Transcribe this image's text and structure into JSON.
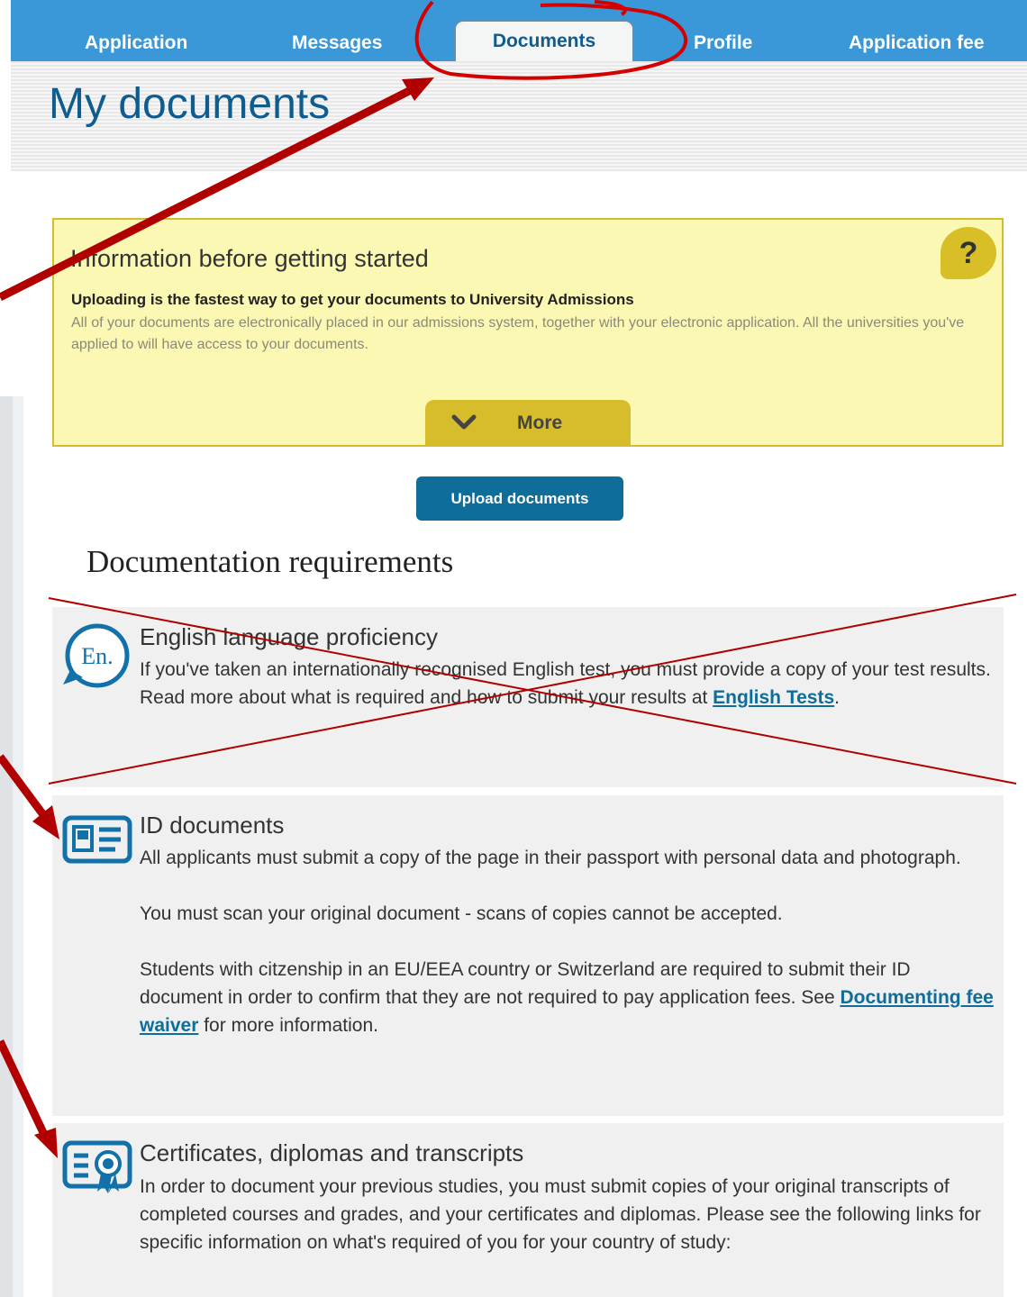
{
  "nav": {
    "tabs": [
      {
        "label": "Application"
      },
      {
        "label": "Messages"
      },
      {
        "label": "Documents",
        "active": true
      },
      {
        "label": "Profile"
      },
      {
        "label": "Application fee"
      }
    ]
  },
  "page": {
    "title": "My documents"
  },
  "info_box": {
    "heading": "Information before getting started",
    "subheading": "Uploading is the fastest way to get your documents to University Admissions",
    "body": "All of your documents are electronically placed in our admissions system, together with your electronic application. All the universities you've applied to will have access to your documents.",
    "help_label": "?",
    "more_label": "More"
  },
  "upload_label": "Upload documents",
  "requirements": {
    "heading": "Documentation requirements",
    "english": {
      "title": "English language proficiency",
      "text": "If you've taken an internationally recognised English test, you must provide a copy of your test results. Read more about what is required and how to submit your results at ",
      "link": "English Tests",
      "suffix": ".",
      "icon_text": "En."
    },
    "id": {
      "title": "ID documents",
      "p1": "All applicants must submit a copy of the page in their passport with personal data and photograph.",
      "p2": "You must scan your original document - scans of copies cannot be accepted.",
      "p3_before": "Students with citzenship in an EU/EEA country or Switzerland are required to submit their ID document in order to confirm that they are not required to pay application fees. See ",
      "p3_link": "Documenting fee waiver",
      "p3_after": " for more information."
    },
    "certificates": {
      "title": "Certificates, diplomas and transcripts",
      "text": "In order to document your previous studies, you must submit copies of your original transcripts of completed courses and grades, and your certificates and diplomas. Please see the following links for specific information on what's required of you for your country of study:"
    }
  },
  "annotation_color": "#c00000",
  "icon_color": "#1171a8"
}
